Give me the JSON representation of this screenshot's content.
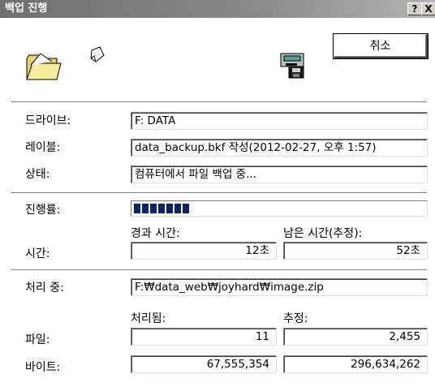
{
  "window": {
    "title": "백업 진행",
    "help_label": "?",
    "close_label": "X"
  },
  "cancel_label": "취소",
  "drive": {
    "label": "드라이브:",
    "value": "F: DATA"
  },
  "volume_label": {
    "label": "레이블:",
    "value": "data_backup.bkf 작성(2012-02-27, 오후 1:57)"
  },
  "status": {
    "label": "상태:",
    "value": "컴퓨터에서 파일 백업 중..."
  },
  "progress": {
    "label": "진행률:",
    "fraction": 0.2,
    "segments_filled": 7
  },
  "time": {
    "label": "시간:",
    "elapsed_label": "경과 시간:",
    "elapsed_value": "12초",
    "remaining_label": "남은 시간(추정):",
    "remaining_value": "52초"
  },
  "processing": {
    "label": "처리 중:",
    "value": "F:₩data_web₩joyhard₩image.zip"
  },
  "counts": {
    "processed_label": "처리됨:",
    "estimated_label": "추정:",
    "files_label": "파일:",
    "files_processed": "11",
    "files_estimated": "2,455",
    "bytes_label": "바이트:",
    "bytes_processed": "67,555,354",
    "bytes_estimated": "296,634,262"
  },
  "icons": {
    "folder": "open-folder-icon",
    "document": "flying-document-icon",
    "tape_drive": "backup-drive-icon"
  }
}
